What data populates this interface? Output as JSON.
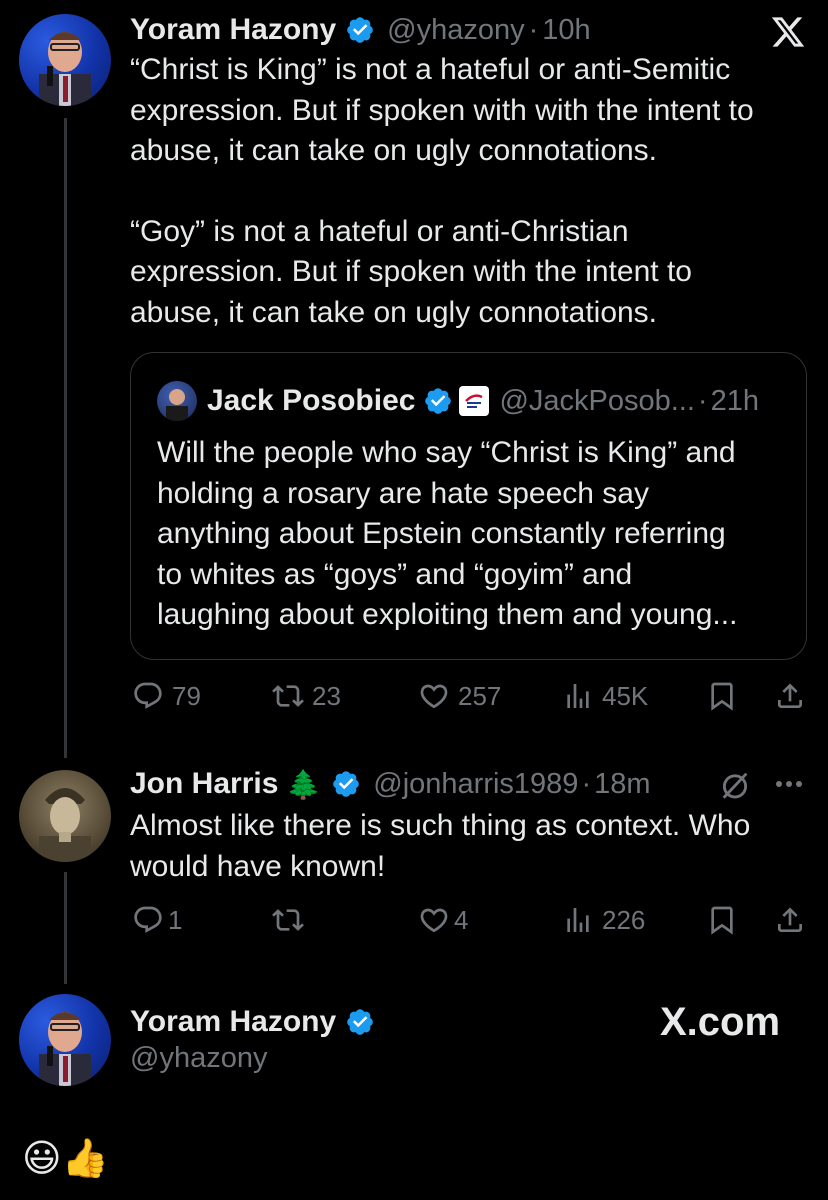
{
  "main_tweet": {
    "name": "Yoram Hazony",
    "handle": "@yhazony",
    "time": "10h",
    "text_p1_lines": [
      "“Christ is King” is not a hateful or anti-Semitic",
      "expression. But if spoken with with the intent to",
      "abuse, it can take on ugly connotations."
    ],
    "text_p2_lines": [
      "“Goy” is not a hateful or anti-Christian",
      "expression. But if spoken with the intent to",
      "abuse, it can take on ugly connotations."
    ],
    "quote": {
      "name": "Jack Posobiec",
      "handle": "@JackPosob...",
      "time": "21h",
      "text_lines": [
        "Will the people who say “Christ is King” and",
        "holding a rosary are hate speech say",
        "anything about Epstein constantly referring",
        "to whites as “goys” and “goyim” and",
        "laughing about exploiting them and young..."
      ]
    },
    "stats": {
      "replies": "79",
      "reposts": "23",
      "likes": "257",
      "views": "45K"
    }
  },
  "reply_tweet": {
    "name": "Jon Harris",
    "name_emoji": "🌲",
    "handle": "@jonharris1989",
    "time": "18m",
    "text_lines": [
      "Almost like there is such thing as context. Who",
      "would have known!"
    ],
    "stats": {
      "replies": "1",
      "reposts": "",
      "likes": "4",
      "views": "226"
    }
  },
  "footer": {
    "name": "Yoram Hazony",
    "handle": "@yhazony",
    "brand": "X.com",
    "emojis": "😃👍"
  },
  "dot_sep": "·",
  "colors": {
    "verified": "#1d9bf0",
    "muted": "#71767b",
    "text": "#e7e9ea",
    "border": "#2f3336"
  },
  "icons": [
    "x-logo-icon",
    "verified-badge-icon",
    "reply-icon",
    "repost-icon",
    "like-icon",
    "views-icon",
    "bookmark-icon",
    "share-icon",
    "mute-icon",
    "more-icon"
  ]
}
